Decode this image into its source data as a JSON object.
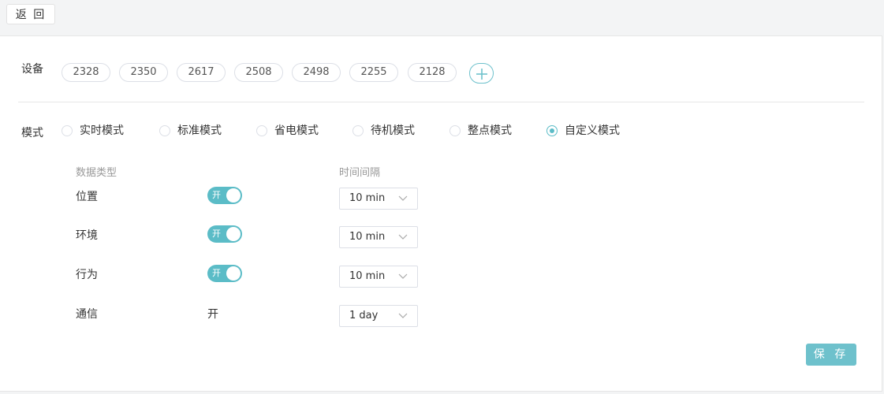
{
  "header": {
    "back_label": "返 回"
  },
  "devices": {
    "label": "设备",
    "chips": [
      "2328",
      "2350",
      "2617",
      "2508",
      "2498",
      "2255",
      "2128"
    ],
    "add_icon": "plus-icon"
  },
  "mode": {
    "label": "模式",
    "options": [
      "实时模式",
      "标准模式",
      "省电模式",
      "待机模式",
      "整点模式",
      "自定义模式"
    ],
    "selected": "自定义模式"
  },
  "custom": {
    "col_type": "数据类型",
    "col_interval": "时间间隔",
    "rows": [
      {
        "label": "位置",
        "switch_text": "开",
        "interval": "10 min"
      },
      {
        "label": "环境",
        "switch_text": "开",
        "interval": "10 min"
      },
      {
        "label": "行为",
        "switch_text": "开",
        "interval": "10 min"
      },
      {
        "label": "通信",
        "static_value": "开",
        "interval": "1 day"
      }
    ]
  },
  "footer": {
    "save_label": "保 存"
  },
  "colors": {
    "accent": "#5bbcc7",
    "button": "#6ec1cc"
  }
}
